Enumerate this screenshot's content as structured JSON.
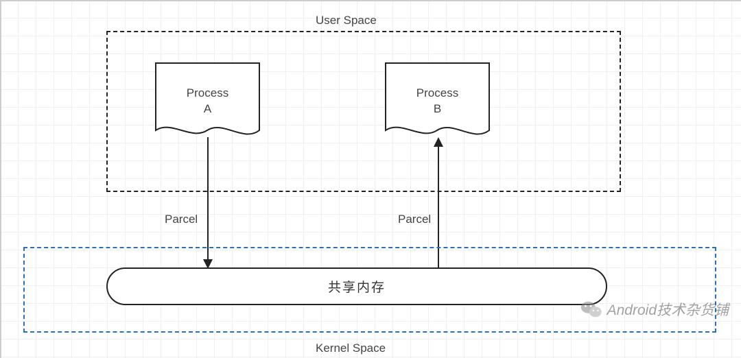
{
  "user_space_label": "User Space",
  "kernel_space_label": "Kernel Space",
  "process_a": {
    "name": "Process",
    "id": "A"
  },
  "process_b": {
    "name": "Process",
    "id": "B"
  },
  "arrow_a_label": "Parcel",
  "arrow_b_label": "Parcel",
  "shared_memory_label": "共享内存",
  "watermark_text": "Android技术杂货铺",
  "colors": {
    "user_space_border": "#222222",
    "kernel_space_border": "#2b6fb5",
    "grid": "#eef0f2"
  }
}
